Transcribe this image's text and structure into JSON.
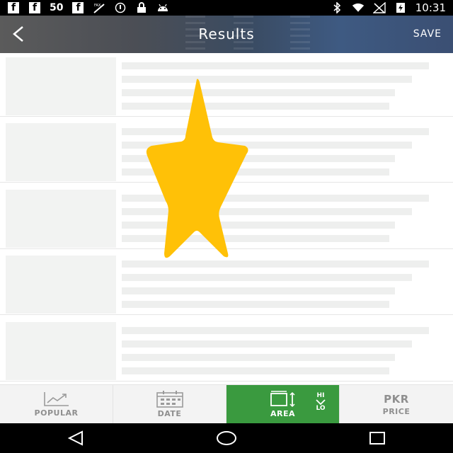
{
  "status_bar": {
    "icons_left": [
      "facebook-icon",
      "facebook-icon",
      "facebook-icon",
      "fax-icon",
      "data-saver-icon",
      "lock-icon",
      "android-icon"
    ],
    "badge_text": "50",
    "fax_text": "FAX",
    "icons_right": [
      "bluetooth-icon",
      "wifi-icon",
      "signal-off-icon",
      "battery-charging-icon"
    ],
    "time": "10:31"
  },
  "app_bar": {
    "title": "Results",
    "save_label": "SAVE",
    "back_icon": "back-icon"
  },
  "results": {
    "rows": [
      {
        "state": "loading"
      },
      {
        "state": "loading"
      },
      {
        "state": "loading"
      },
      {
        "state": "loading"
      },
      {
        "state": "loading"
      }
    ]
  },
  "overlay": {
    "icon": "star-icon",
    "color": "#ffc107"
  },
  "sort_bar": {
    "popular_label": "POPULAR",
    "date_label": "DATE",
    "area_label": "AREA",
    "area_hi": "HI",
    "area_lo": "LO",
    "price_currency": "PKR",
    "price_label": "PRICE",
    "active_color": "#3a9a3f"
  },
  "nav_bar": {
    "buttons": [
      "back-triangle-icon",
      "home-circle-icon",
      "recents-square-icon"
    ]
  }
}
